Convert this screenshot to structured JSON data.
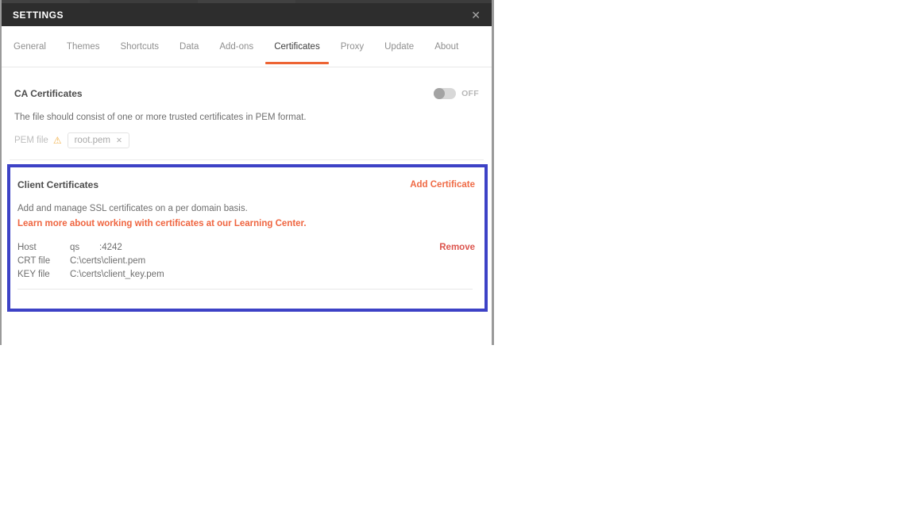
{
  "window": {
    "title": "SETTINGS",
    "close_icon": "✕"
  },
  "tabs": {
    "items": [
      {
        "label": "General"
      },
      {
        "label": "Themes"
      },
      {
        "label": "Shortcuts"
      },
      {
        "label": "Data"
      },
      {
        "label": "Add-ons"
      },
      {
        "label": "Certificates"
      },
      {
        "label": "Proxy"
      },
      {
        "label": "Update"
      },
      {
        "label": "About"
      }
    ],
    "active_tab": "Certificates"
  },
  "ca_section": {
    "title": "CA Certificates",
    "toggle_state": "OFF",
    "description": "The file should consist of one or more trusted certificates in PEM format.",
    "pem_file_label": "PEM file",
    "warning_icon": "⚠",
    "file_chip": {
      "filename": "root.pem",
      "remove_icon": "✕"
    }
  },
  "client_section": {
    "title": "Client Certificates",
    "add_certificate_label": "Add Certificate",
    "description": "Add and manage SSL certificates on a per domain basis.",
    "learn_more_link": "Learn more about working with certificates at our Learning Center.",
    "certificate": {
      "host_label": "Host",
      "host_name": "qs",
      "host_port": ":4242",
      "crt_label": "CRT file",
      "crt_value": "C:\\certs\\client.pem",
      "key_label": "KEY file",
      "key_value": "C:\\certs\\client_key.pem",
      "remove_label": "Remove"
    }
  },
  "colors": {
    "accent_orange": "#ed6434",
    "link_orange": "#ef6540",
    "highlight_blue": "#3d42c6",
    "remove_red": "#dc554e",
    "warning_amber": "#f2b24c",
    "header_dark": "#2d2d2d"
  }
}
